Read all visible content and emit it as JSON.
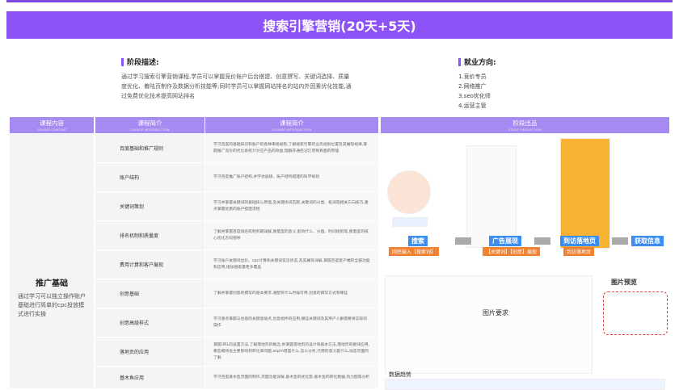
{
  "banner": {
    "title": "搜索引擎营销(20天+5天)"
  },
  "stage_desc": {
    "heading": "阶段描述:",
    "body": "通过学习搜索引擎营销课程,学员可以掌握竞价账户后台搭建、创意撰写、关键词选择、质量度优化、着陆页制作及数据分析技能等;同时学员可以掌握网站排名的站内外因素优化技能,通过免费优化技术提高网站排名"
  },
  "career": {
    "heading": "就业方向:",
    "items": [
      "1.竞价专员",
      "2.网络推广",
      "3.seo优化师",
      "4.运营主管"
    ]
  },
  "table": {
    "headers": [
      {
        "label": "课程内容",
        "sub": "COURSE CONTENT"
      },
      {
        "label": "课程简介",
        "sub": "COURSE INTRODUCTION"
      },
      {
        "label": "课程简介",
        "sub": "COURSE INTRODUCTION"
      },
      {
        "label": "阶段出品",
        "sub": "STAGE PRODUCTION"
      }
    ],
    "module_title": "推广基础",
    "module_desc": "通过学习可以独立操作账户基础进行简单的cpc投放模式进行实操",
    "rows": [
      {
        "name": "百度基础和推广规则",
        "desc": "学习百度的基础知识和账户的各种审核规则,了解搜索引擎的业务规划位置及其展现规律,掌握推广竞价的优化系统计对应产品的效益,理解开通后记忆营销真面的原理"
      },
      {
        "name": "账户结构",
        "desc": "学习百度推广账户结构,并学会层级、账户结构搭建的科学规划"
      },
      {
        "name": "关键词策划",
        "desc": "学习并掌握关键词的基础核心原理,及关键拆词匹配,关键词的分类、拓词等相关方向技巧,重点掌握优质的账户搭建流程"
      },
      {
        "name": "排名机制和质量度",
        "desc": "了解并掌握百度排名机制到期详解,质量度的意义,影响什么、分值、时间规则等,质量度的核心优化方向指导"
      },
      {
        "name": "费用计算和客户展现",
        "desc": "学习账户关键词出价、cpc计算和关键词常见状态,及其展现详解,掌握百度客户端的全部功能和应用,增加搜索量更多覆盖"
      },
      {
        "name": "创意基础",
        "desc": "了解并掌握创意的撰写的基本要求,通配符什么时候可用,创意的撰写方式有哪些"
      },
      {
        "name": "创意高级样式",
        "desc": "学习重点掌握与创意的关键意境点,创意组件的应用,哪些关键词及其用户人群需要将实际的操作"
      },
      {
        "name": "落地页的应用",
        "desc": "掌握URL的设置方法,了解落地页的概念,并掌握落地页的设计和基本方法,落地页的模块应用,哪些模块会主要影响到转化率问题,ocpm借是什么,怎么分析,代用的意义是什么,动态页面的了解"
      },
      {
        "name": "基木鱼应用",
        "desc": "学习百度基木鱼页面的制作,页面功能详解,基木鱼的优化势,基木鱼的转化数据,热力图等分析"
      }
    ]
  },
  "production": {
    "labels": [
      "搜索",
      "广告展现",
      "到访落地页",
      "获取信息"
    ],
    "sublabels": [
      "网民输入【搜索词】",
      "【关键词】【创意】展现",
      "到访落地页"
    ],
    "preview_title": "图片预览",
    "upload_hint": "图片要求",
    "data_title": "数据趋势"
  },
  "colors": {
    "accent": "#8c52f5",
    "header": "#a58af2",
    "blue_tag": "#3b8ef0",
    "orange_tag": "#f08232"
  }
}
